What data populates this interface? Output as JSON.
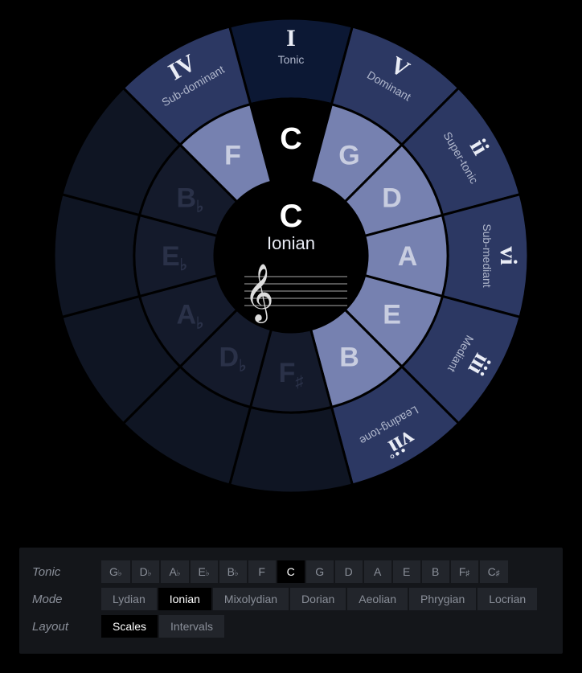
{
  "center": {
    "note": "C",
    "mode": "Ionian"
  },
  "outer": [
    {
      "roman": "I",
      "label": "Tonic",
      "active": true,
      "tonic": true
    },
    {
      "roman": "V",
      "label": "Dominant",
      "active": true,
      "tonic": false
    },
    {
      "roman": "ii",
      "label": "Super-tonic",
      "active": true,
      "tonic": false
    },
    {
      "roman": "vi",
      "label": "Sub-mediant",
      "active": true,
      "tonic": false
    },
    {
      "roman": "iii",
      "label": "Mediant",
      "active": true,
      "tonic": false
    },
    {
      "roman": "vii°",
      "label": "Leading-tone",
      "active": true,
      "tonic": false
    },
    {
      "roman": "",
      "label": "",
      "active": false,
      "tonic": false
    },
    {
      "roman": "",
      "label": "",
      "active": false,
      "tonic": false
    },
    {
      "roman": "",
      "label": "",
      "active": false,
      "tonic": false
    },
    {
      "roman": "",
      "label": "",
      "active": false,
      "tonic": false
    },
    {
      "roman": "",
      "label": "",
      "active": false,
      "tonic": false
    },
    {
      "roman": "IV",
      "label": "Sub-dominant",
      "active": true,
      "tonic": false
    }
  ],
  "inner": [
    {
      "note": "C",
      "accidental": "",
      "active": true,
      "tonic": true
    },
    {
      "note": "G",
      "accidental": "",
      "active": true,
      "tonic": false
    },
    {
      "note": "D",
      "accidental": "",
      "active": true,
      "tonic": false
    },
    {
      "note": "A",
      "accidental": "",
      "active": true,
      "tonic": false
    },
    {
      "note": "E",
      "accidental": "",
      "active": true,
      "tonic": false
    },
    {
      "note": "B",
      "accidental": "",
      "active": true,
      "tonic": false
    },
    {
      "note": "F",
      "accidental": "♯",
      "active": false,
      "tonic": false
    },
    {
      "note": "D",
      "accidental": "♭",
      "active": false,
      "tonic": false
    },
    {
      "note": "A",
      "accidental": "♭",
      "active": false,
      "tonic": false
    },
    {
      "note": "E",
      "accidental": "♭",
      "active": false,
      "tonic": false
    },
    {
      "note": "B",
      "accidental": "♭",
      "active": false,
      "tonic": false
    },
    {
      "note": "F",
      "accidental": "",
      "active": true,
      "tonic": false
    }
  ],
  "controls": {
    "tonic": {
      "label": "Tonic",
      "options": [
        "G♭",
        "D♭",
        "A♭",
        "E♭",
        "B♭",
        "F",
        "C",
        "G",
        "D",
        "A",
        "E",
        "B",
        "F♯",
        "C♯"
      ],
      "selected": "C"
    },
    "mode": {
      "label": "Mode",
      "options": [
        "Lydian",
        "Ionian",
        "Mixolydian",
        "Dorian",
        "Aeolian",
        "Phrygian",
        "Locrian"
      ],
      "selected": "Ionian"
    },
    "layout": {
      "label": "Layout",
      "options": [
        "Scales",
        "Intervals"
      ],
      "selected": "Scales"
    }
  }
}
